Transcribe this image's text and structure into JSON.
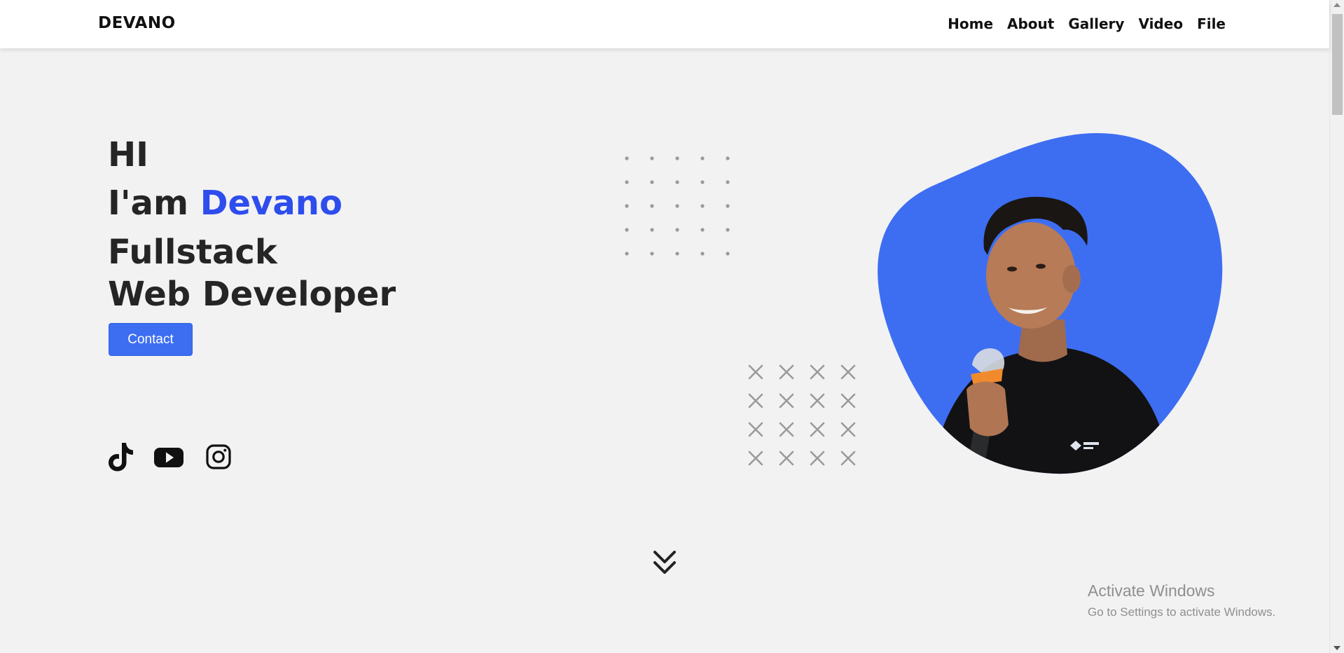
{
  "navbar": {
    "brand": "DEVANO",
    "links": [
      "Home",
      "About",
      "Gallery",
      "Video",
      "File"
    ]
  },
  "hero": {
    "greeting": "HI",
    "intro_prefix": "I'am",
    "name": "Devano",
    "role_line1": "Fullstack",
    "role_line2": "Web Developer",
    "contact_label": "Contact"
  },
  "social_icons": [
    "tiktok-icon",
    "youtube-icon",
    "instagram-icon"
  ],
  "colors": {
    "accent": "#2e4ded",
    "button": "#3d6ef2",
    "blob": "#3d6ef2",
    "background": "#f2f2f3"
  },
  "watermark": {
    "title": "Activate Windows",
    "subtitle": "Go to Settings to activate Windows."
  }
}
